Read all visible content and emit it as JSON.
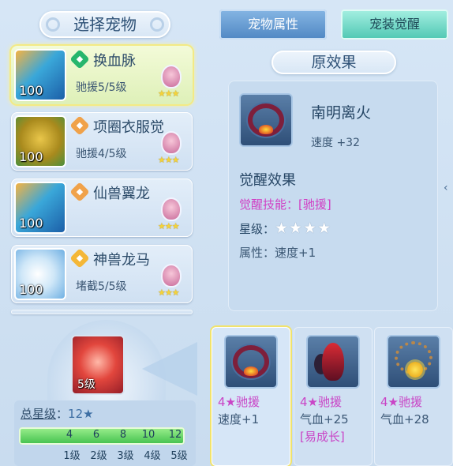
{
  "left": {
    "title": "选择宠物",
    "pets": [
      {
        "name": "换血脉",
        "sub": "驰援5/5级",
        "level": "100",
        "badge": "◆",
        "badge_color": "#27b66d",
        "active": true
      },
      {
        "name": "项圈衣服觉",
        "sub": "驰援4/5级",
        "level": "100",
        "badge": "◆",
        "badge_color": "#f0a24a",
        "active": false
      },
      {
        "name": "仙兽翼龙",
        "sub": "",
        "level": "100",
        "badge": "◆",
        "badge_color": "#f0a24a",
        "active": false
      },
      {
        "name": "神兽龙马",
        "sub": "堵截5/5级",
        "level": "100",
        "badge": "◆",
        "badge_color": "#f4b737",
        "active": false
      }
    ],
    "stars_small": "★★★"
  },
  "tabs": {
    "attr": "宠物属性",
    "awake": "宠装觉醒"
  },
  "original": {
    "title": "原效果",
    "item_name": "南明离火",
    "item_stat": "速度 +32",
    "awaken_header": "觉醒效果",
    "awaken_skill": "觉醒技能：[驰援]",
    "star_label": "星级：",
    "star_value": "★★★★",
    "attr": "属性：速度+1"
  },
  "total": {
    "item_level": "5级",
    "label": "总星级",
    "colon": "：",
    "value": "12★",
    "ticks": [
      "4",
      "6",
      "8",
      "10",
      "12"
    ],
    "levels": [
      "1级",
      "2级",
      "3级",
      "4级",
      "5级"
    ]
  },
  "equips": [
    {
      "title": "4★驰援",
      "stat": "速度+1",
      "extra": ""
    },
    {
      "title": "4★驰援",
      "stat": "气血+25",
      "extra": "[易成长]"
    },
    {
      "title": "4★驰援",
      "stat": "气血+28",
      "extra": ""
    }
  ],
  "colors": {
    "accent_pink": "#c944c6",
    "tab_blue": "#4f87c3",
    "tab_teal": "#4ec7b3",
    "bar_green": "#3fbf4b"
  }
}
